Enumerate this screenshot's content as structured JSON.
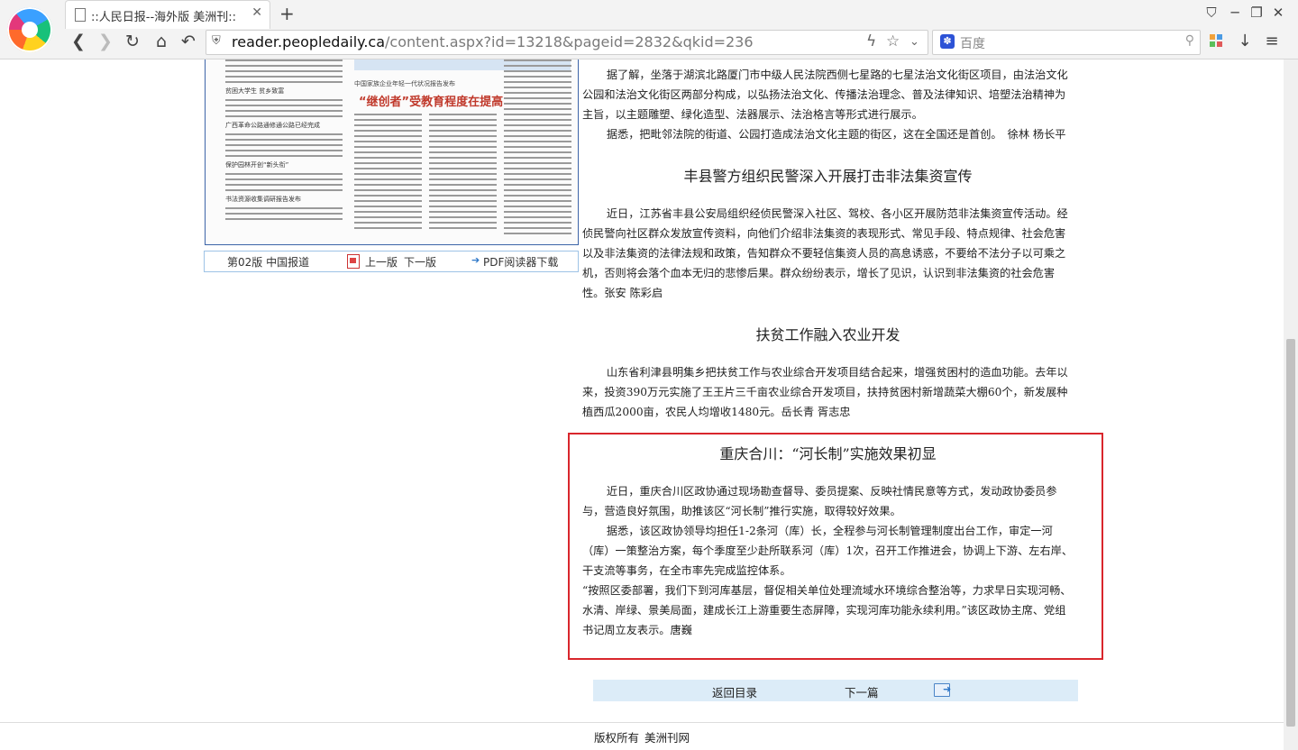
{
  "browser": {
    "tab_title": "::人民日报--海外版 美洲刊::",
    "tab_close": "✕",
    "new_tab": "+",
    "url_host": "reader.peopledaily.ca",
    "url_path": "/content.aspx?id=13218&pageid=2832&qkid=236",
    "search_placeholder": "百度",
    "nav_icons": [
      "back-icon",
      "forward-icon",
      "reload-icon",
      "home-icon",
      "undo-close-icon"
    ],
    "window_icons": [
      "shirt-icon",
      "minimize-icon",
      "maximize-icon",
      "close-icon"
    ],
    "tool_icons": [
      "apps-icon",
      "download-icon",
      "menu-icon"
    ]
  },
  "newspaper": {
    "sub": "中国家族企业年轻一代状况报告发布",
    "headline": "“继创者”受教育程度在提高",
    "small_heads": [
      "贫困大学生  贫乡致富",
      "广西革命公路通修通公路已经完成",
      "保护园林开创“新头衔”",
      "书法资源收集调研报告发布"
    ]
  },
  "page_nav": {
    "edition": "第02版 中国报道",
    "prev": "上一版",
    "next": "下一版",
    "pdf": "PDF阅读器下载"
  },
  "article": {
    "top_fragment": "据了解，坐落于湖滨北路厦门市中级人民法院西侧七星路的七星法治文化街区项目，由法治文化公园和法治文化街区两部分构成，以弘扬法治文化、传播法治理念、普及法律知识、培塑法治精神为主旨，以主题雕塑、绿化造型、法器展示、法治格言等形式进行展示。",
    "top_fragment2": "据悉，把毗邻法院的街道、公园打造成法治文化主题的街区，这在全国还是首创。　徐林 杨长平",
    "s1_title": "丰县警方组织民警深入开展打击非法集资宣传",
    "s1_body": "近日，江苏省丰县公安局组织经侦民警深入社区、驾校、各小区开展防范非法集资宣传活动。经侦民警向社区群众发放宣传资料，向他们介绍非法集资的表现形式、常见手段、特点规律、社会危害以及非法集资的法律法规和政策，告知群众不要轻信集资人员的高息诱惑，不要给不法分子以可乘之机，否则将会落个血本无归的悲惨后果。群众纷纷表示，增长了见识，认识到非法集资的社会危害性。张安 陈彩启",
    "s2_title": "扶贫工作融入农业开发",
    "s2_body": "山东省利津县明集乡把扶贫工作与农业综合开发项目结合起来，增强贫困村的造血功能。去年以来，投资390万元实施了王王片三千亩农业综合开发项目，扶持贫困村新增蔬菜大棚60个，新发展种植西瓜2000亩，农民人均增收1480元。岳长青 胥志忠",
    "s3_title": "重庆合川：“河长制”实施效果初显",
    "s3_p1": "近日，重庆合川区政协通过现场勘查督导、委员提案、反映社情民意等方式，发动政协委员参与，营造良好氛围，助推该区“河长制”推行实施，取得较好效果。",
    "s3_p2": "据悉，该区政协领导均担任1-2条河（库）长，全程参与河长制管理制度出台工作，审定一河（库）一策整治方案，每个季度至少赴所联系河（库）1次，召开工作推进会，协调上下游、左右岸、干支流等事务，在全市率先完成监控体系。",
    "s3_p3": "“按照区委部署，我们下到河库基层，督促相关单位处理流域水环境综合整治等，力求早日实现河畅、水清、岸绿、景美局面，建成长江上游重要生态屏障，实现河库功能永续利用。”该区政协主席、党组书记周立友表示。唐巍"
  },
  "bottom_nav": {
    "back": "返回目录",
    "next": "下一篇"
  },
  "footer": {
    "copyright": "版权所有",
    "site": "美洲刊网"
  }
}
